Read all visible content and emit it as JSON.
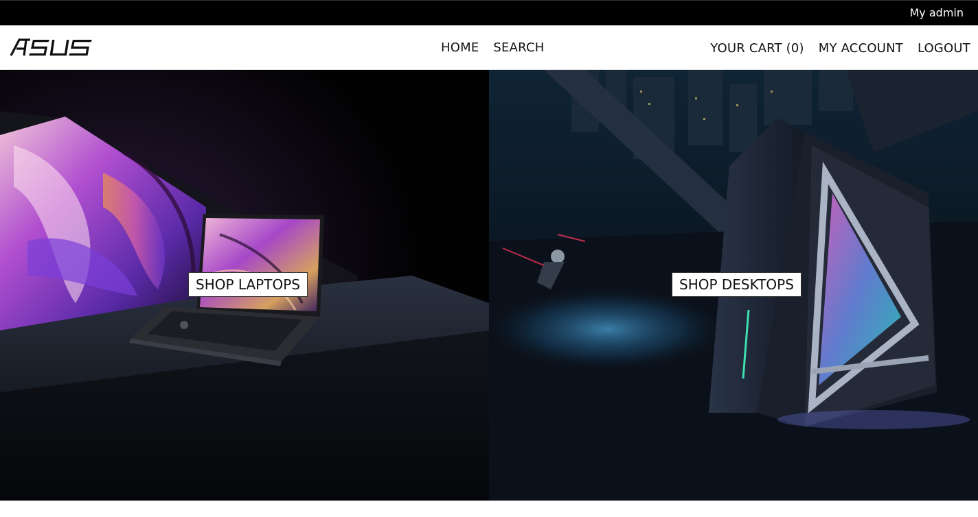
{
  "topbar": {
    "user_label": "My admin"
  },
  "brand": {
    "logo_text": "ASUS"
  },
  "nav": {
    "home": "HOME",
    "search": "SEARCH",
    "cart": "YOUR CART (0)",
    "account": "MY ACCOUNT",
    "logout": "LOGOUT"
  },
  "hero": {
    "laptops_button": "SHOP LAPTOPS",
    "desktops_button": "SHOP DESKTOPS"
  },
  "colors": {
    "topbar_bg": "#000000",
    "nav_bg": "#ffffff",
    "accent_purple": "#9b3fd0",
    "accent_pink": "#e26fa8",
    "accent_blue": "#3a7fc4"
  }
}
